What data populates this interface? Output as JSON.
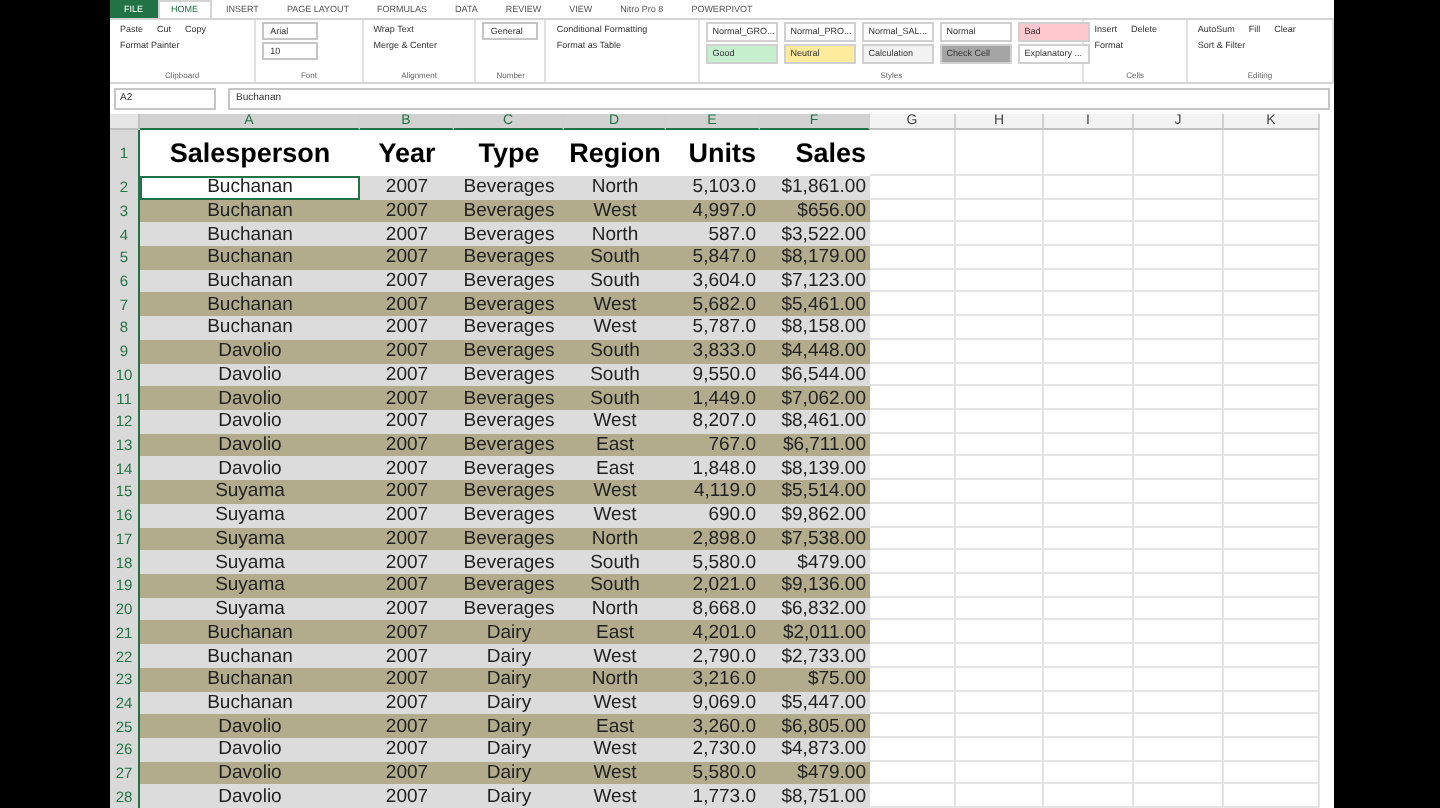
{
  "ribbon": {
    "tabs": [
      {
        "label": "FILE",
        "selected": false
      },
      {
        "label": "HOME",
        "selected": true
      },
      {
        "label": "INSERT",
        "selected": false
      },
      {
        "label": "PAGE LAYOUT",
        "selected": false
      },
      {
        "label": "FORMULAS",
        "selected": false
      },
      {
        "label": "DATA",
        "selected": false
      },
      {
        "label": "REVIEW",
        "selected": false
      },
      {
        "label": "VIEW",
        "selected": false
      },
      {
        "label": "Nitro Pro 8",
        "selected": false
      },
      {
        "label": "POWERPIVOT",
        "selected": false
      }
    ],
    "groups": [
      {
        "label": "Clipboard",
        "items": [
          {
            "kind": "button",
            "label": "Paste"
          },
          {
            "kind": "button",
            "label": "Cut"
          },
          {
            "kind": "button",
            "label": "Copy"
          },
          {
            "kind": "button",
            "label": "Format Painter"
          }
        ]
      },
      {
        "label": "Font",
        "items": [
          {
            "kind": "field",
            "label": "Arial"
          },
          {
            "kind": "field",
            "label": "10"
          }
        ]
      },
      {
        "label": "Alignment",
        "items": [
          {
            "kind": "button",
            "label": "Wrap Text"
          },
          {
            "kind": "button",
            "label": "Merge & Center"
          }
        ]
      },
      {
        "label": "Number",
        "items": [
          {
            "kind": "field",
            "label": "General"
          }
        ]
      },
      {
        "items": [
          {
            "kind": "button",
            "label": "Conditional Formatting"
          },
          {
            "kind": "button",
            "label": "Format as Table"
          }
        ]
      },
      {
        "label": "Styles",
        "items": [
          {
            "kind": "style",
            "label": "Normal_GRO...",
            "color": "#ffffff"
          },
          {
            "kind": "style",
            "label": "Normal_PRO...",
            "color": "#ffffff"
          },
          {
            "kind": "style",
            "label": "Normal_SAL...",
            "color": "#ffffff"
          },
          {
            "kind": "style",
            "label": "Normal",
            "color": "#ffffff"
          },
          {
            "kind": "style",
            "label": "Bad",
            "color": "#ffc7ce"
          },
          {
            "kind": "style",
            "label": "Good",
            "color": "#c6efce"
          },
          {
            "kind": "style",
            "label": "Neutral",
            "color": "#ffeb9c"
          },
          {
            "kind": "style",
            "label": "Calculation",
            "color": "#f2f2f2"
          },
          {
            "kind": "style",
            "label": "Check Cell",
            "color": "#a5a5a5"
          },
          {
            "kind": "style",
            "label": "Explanatory ...",
            "color": "#ffffff"
          }
        ]
      },
      {
        "label": "Cells",
        "items": [
          {
            "kind": "button",
            "label": "Insert"
          },
          {
            "kind": "button",
            "label": "Delete"
          },
          {
            "kind": "button",
            "label": "Format"
          }
        ]
      },
      {
        "label": "Editing",
        "items": [
          {
            "kind": "button",
            "label": "AutoSum"
          },
          {
            "kind": "button",
            "label": "Fill"
          },
          {
            "kind": "button",
            "label": "Clear"
          },
          {
            "kind": "button",
            "label": "Sort & Filter"
          }
        ]
      }
    ]
  },
  "formula_bar": {
    "name_box": "A2",
    "value": "Buchanan"
  },
  "columns": [
    {
      "label": "A",
      "selected": true
    },
    {
      "label": "B",
      "selected": true
    },
    {
      "label": "C",
      "selected": true
    },
    {
      "label": "D",
      "selected": true
    },
    {
      "label": "E",
      "selected": true
    },
    {
      "label": "F",
      "selected": true
    },
    {
      "label": "G",
      "selected": false
    },
    {
      "label": "H",
      "selected": false
    },
    {
      "label": "I",
      "selected": false
    },
    {
      "label": "J",
      "selected": false
    },
    {
      "label": "K",
      "selected": false
    }
  ],
  "header_row": {
    "number": "1",
    "cells": [
      "Salesperson",
      "Year",
      "Type",
      "Region",
      "Units",
      "Sales"
    ]
  },
  "rows": [
    {
      "number": "2",
      "active": true,
      "cells": [
        "Buchanan",
        "2007",
        "Beverages",
        "North",
        "5,103.0",
        "$1,861.00"
      ]
    },
    {
      "number": "3",
      "active": false,
      "cells": [
        "Buchanan",
        "2007",
        "Beverages",
        "West",
        "4,997.0",
        "$656.00"
      ]
    },
    {
      "number": "4",
      "active": false,
      "cells": [
        "Buchanan",
        "2007",
        "Beverages",
        "North",
        "587.0",
        "$3,522.00"
      ]
    },
    {
      "number": "5",
      "active": false,
      "cells": [
        "Buchanan",
        "2007",
        "Beverages",
        "South",
        "5,847.0",
        "$8,179.00"
      ]
    },
    {
      "number": "6",
      "active": false,
      "cells": [
        "Buchanan",
        "2007",
        "Beverages",
        "South",
        "3,604.0",
        "$7,123.00"
      ]
    },
    {
      "number": "7",
      "active": false,
      "cells": [
        "Buchanan",
        "2007",
        "Beverages",
        "West",
        "5,682.0",
        "$5,461.00"
      ]
    },
    {
      "number": "8",
      "active": false,
      "cells": [
        "Buchanan",
        "2007",
        "Beverages",
        "West",
        "5,787.0",
        "$8,158.00"
      ]
    },
    {
      "number": "9",
      "active": false,
      "cells": [
        "Davolio",
        "2007",
        "Beverages",
        "South",
        "3,833.0",
        "$4,448.00"
      ]
    },
    {
      "number": "10",
      "active": false,
      "cells": [
        "Davolio",
        "2007",
        "Beverages",
        "South",
        "9,550.0",
        "$6,544.00"
      ]
    },
    {
      "number": "11",
      "active": false,
      "cells": [
        "Davolio",
        "2007",
        "Beverages",
        "South",
        "1,449.0",
        "$7,062.00"
      ]
    },
    {
      "number": "12",
      "active": false,
      "cells": [
        "Davolio",
        "2007",
        "Beverages",
        "West",
        "8,207.0",
        "$8,461.00"
      ]
    },
    {
      "number": "13",
      "active": false,
      "cells": [
        "Davolio",
        "2007",
        "Beverages",
        "East",
        "767.0",
        "$6,711.00"
      ]
    },
    {
      "number": "14",
      "active": false,
      "cells": [
        "Davolio",
        "2007",
        "Beverages",
        "East",
        "1,848.0",
        "$8,139.00"
      ]
    },
    {
      "number": "15",
      "active": false,
      "cells": [
        "Suyama",
        "2007",
        "Beverages",
        "West",
        "4,119.0",
        "$5,514.00"
      ]
    },
    {
      "number": "16",
      "active": false,
      "cells": [
        "Suyama",
        "2007",
        "Beverages",
        "West",
        "690.0",
        "$9,862.00"
      ]
    },
    {
      "number": "17",
      "active": false,
      "cells": [
        "Suyama",
        "2007",
        "Beverages",
        "North",
        "2,898.0",
        "$7,538.00"
      ]
    },
    {
      "number": "18",
      "active": false,
      "cells": [
        "Suyama",
        "2007",
        "Beverages",
        "South",
        "5,580.0",
        "$479.00"
      ]
    },
    {
      "number": "19",
      "active": false,
      "cells": [
        "Suyama",
        "2007",
        "Beverages",
        "South",
        "2,021.0",
        "$9,136.00"
      ]
    },
    {
      "number": "20",
      "active": false,
      "cells": [
        "Suyama",
        "2007",
        "Beverages",
        "North",
        "8,668.0",
        "$6,832.00"
      ]
    },
    {
      "number": "21",
      "active": false,
      "cells": [
        "Buchanan",
        "2007",
        "Dairy",
        "East",
        "4,201.0",
        "$2,011.00"
      ]
    },
    {
      "number": "22",
      "active": false,
      "cells": [
        "Buchanan",
        "2007",
        "Dairy",
        "West",
        "2,790.0",
        "$2,733.00"
      ]
    },
    {
      "number": "23",
      "active": false,
      "cells": [
        "Buchanan",
        "2007",
        "Dairy",
        "North",
        "3,216.0",
        "$75.00"
      ]
    },
    {
      "number": "24",
      "active": false,
      "cells": [
        "Buchanan",
        "2007",
        "Dairy",
        "West",
        "9,069.0",
        "$5,447.00"
      ]
    },
    {
      "number": "25",
      "active": false,
      "cells": [
        "Davolio",
        "2007",
        "Dairy",
        "East",
        "3,260.0",
        "$6,805.00"
      ]
    },
    {
      "number": "26",
      "active": false,
      "cells": [
        "Davolio",
        "2007",
        "Dairy",
        "West",
        "2,730.0",
        "$4,873.00"
      ]
    },
    {
      "number": "27",
      "active": false,
      "cells": [
        "Davolio",
        "2007",
        "Dairy",
        "West",
        "5,580.0",
        "$479.00"
      ]
    },
    {
      "number": "28",
      "active": false,
      "cells": [
        "Davolio",
        "2007",
        "Dairy",
        "West",
        "1,773.0",
        "$8,751.00"
      ]
    }
  ]
}
